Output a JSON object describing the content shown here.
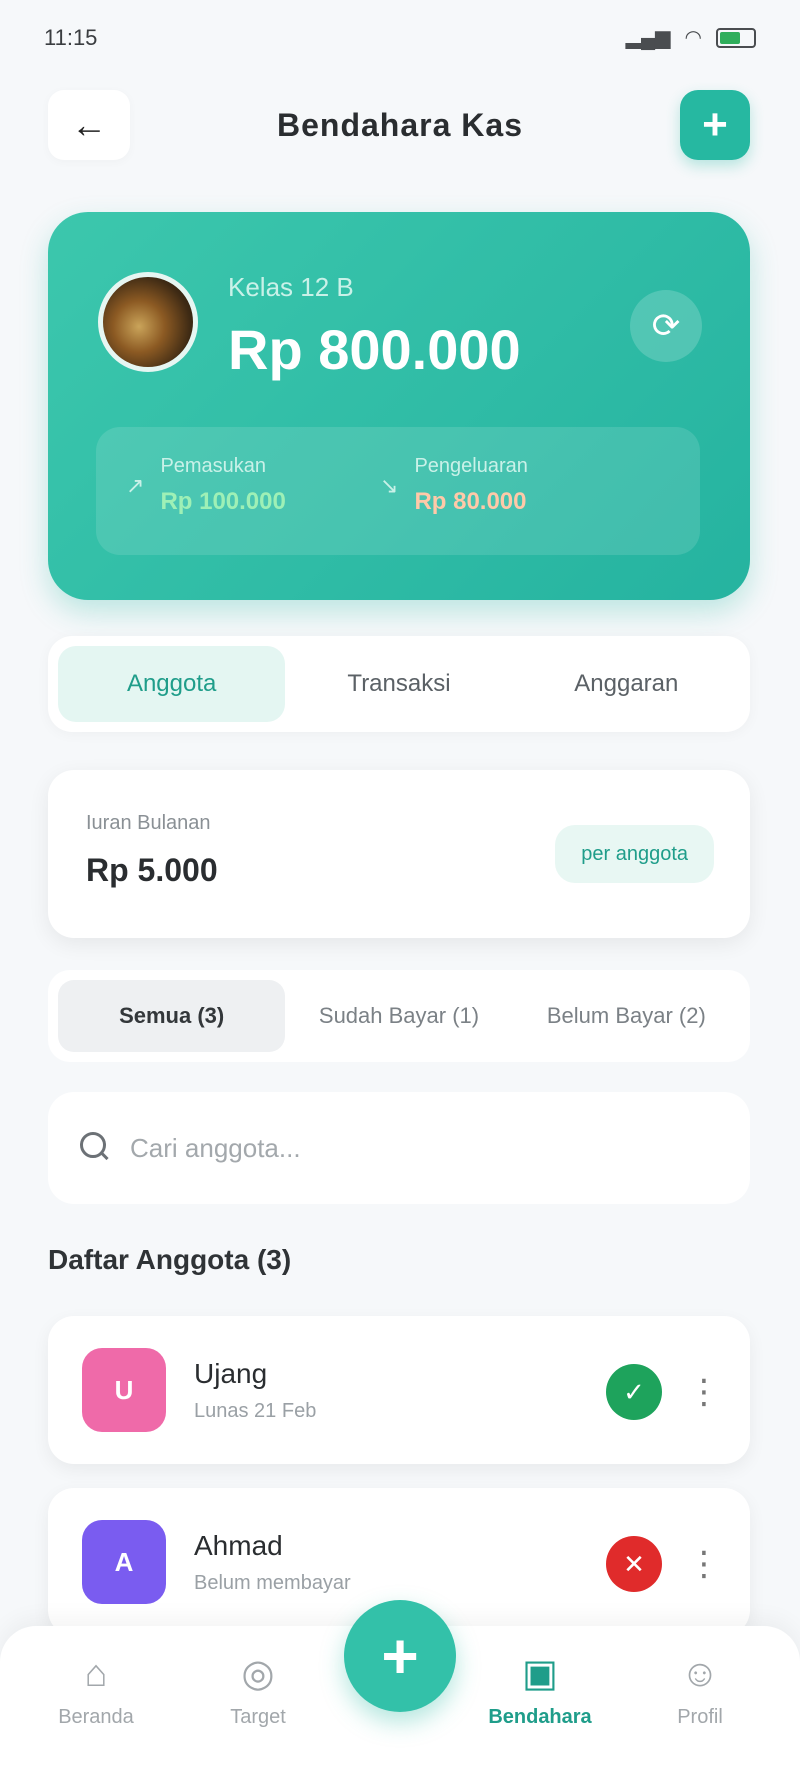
{
  "status_bar": {
    "time": "11:15"
  },
  "header": {
    "title": "Bendahara Kas"
  },
  "balance_card": {
    "class_name": "Kelas 12 B",
    "balance": "Rp 800.000",
    "income": {
      "label": "Pemasukan",
      "value": "Rp 100.000"
    },
    "expense": {
      "label": "Pengeluaran",
      "value": "Rp 80.000"
    }
  },
  "tabs": [
    {
      "label": "Anggota"
    },
    {
      "label": "Transaksi"
    },
    {
      "label": "Anggaran"
    }
  ],
  "fee": {
    "label": "Iuran Bulanan",
    "value": "Rp 5.000",
    "unit": "per anggota"
  },
  "filters": [
    {
      "label": "Semua (3)"
    },
    {
      "label": "Sudah Bayar (1)"
    },
    {
      "label": "Belum Bayar (2)"
    }
  ],
  "search": {
    "placeholder": "Cari anggota..."
  },
  "member_list": {
    "title": "Daftar Anggota (3)",
    "items": [
      {
        "initial": "U",
        "name": "Ujang",
        "status": "Lunas 21 Feb",
        "avatar_color": "#ef6aa9",
        "state": "paid"
      },
      {
        "initial": "A",
        "name": "Ahmad",
        "status": "Belum membayar",
        "avatar_color": "#7a5cf0",
        "state": "unpaid"
      }
    ]
  },
  "bottom_nav": [
    {
      "label": "Beranda",
      "icon": "home-icon"
    },
    {
      "label": "Target",
      "icon": "target-icon"
    },
    {
      "label": "Bendahara",
      "icon": "wallet-icon"
    },
    {
      "label": "Profil",
      "icon": "user-icon"
    }
  ],
  "colors": {
    "accent": "#26b8a1",
    "paid": "#1ea35c",
    "unpaid": "#e02b2b"
  }
}
